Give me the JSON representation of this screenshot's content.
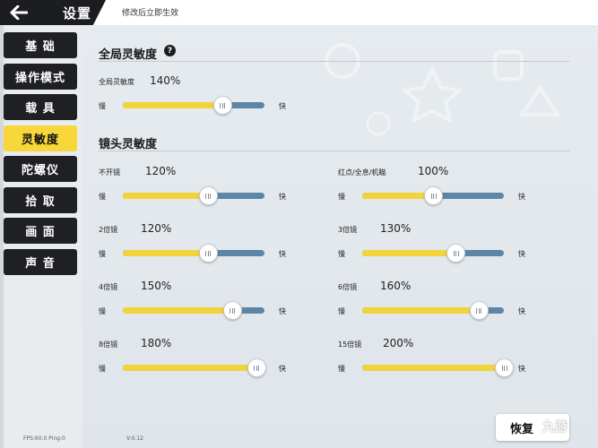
{
  "header": {
    "title": "设置",
    "notice": "修改后立即生效"
  },
  "sidebar": {
    "items": [
      {
        "label": "基 础",
        "active": false
      },
      {
        "label": "操作模式",
        "active": false
      },
      {
        "label": "载 具",
        "active": false
      },
      {
        "label": "灵敏度",
        "active": true
      },
      {
        "label": "陀螺仪",
        "active": false
      },
      {
        "label": "拾 取",
        "active": false
      },
      {
        "label": "画 面",
        "active": false
      },
      {
        "label": "声 音",
        "active": false
      }
    ],
    "fps": "FPS:60.0 Ping:0",
    "version": "V:0.12"
  },
  "global": {
    "title": "全局灵敏度",
    "help": "?",
    "label": "全局灵敏度",
    "value": "140%",
    "level": 0.7,
    "slow": "慢",
    "fast": "快"
  },
  "scope": {
    "title": "镜头灵敏度",
    "slow": "慢",
    "fast": "快",
    "items": [
      {
        "label": "不开镜",
        "value": "120%",
        "level": 0.6
      },
      {
        "label": "红点/全息/机瞄",
        "value": "100%",
        "level": 0.5
      },
      {
        "label": "2倍镜",
        "value": "120%",
        "level": 0.6
      },
      {
        "label": "3倍镜",
        "value": "130%",
        "level": 0.66
      },
      {
        "label": "4倍镜",
        "value": "150%",
        "level": 0.77
      },
      {
        "label": "6倍镜",
        "value": "160%",
        "level": 0.82
      },
      {
        "label": "8倍镜",
        "value": "180%",
        "level": 0.94
      },
      {
        "label": "15倍镜",
        "value": "200%",
        "level": 1.0
      }
    ]
  },
  "footer": {
    "reset_label": "恢复",
    "watermark": "九游"
  },
  "colors": {
    "accent": "#f7d73a",
    "track": "#5d86a6",
    "nav_bg": "#1f2023"
  }
}
